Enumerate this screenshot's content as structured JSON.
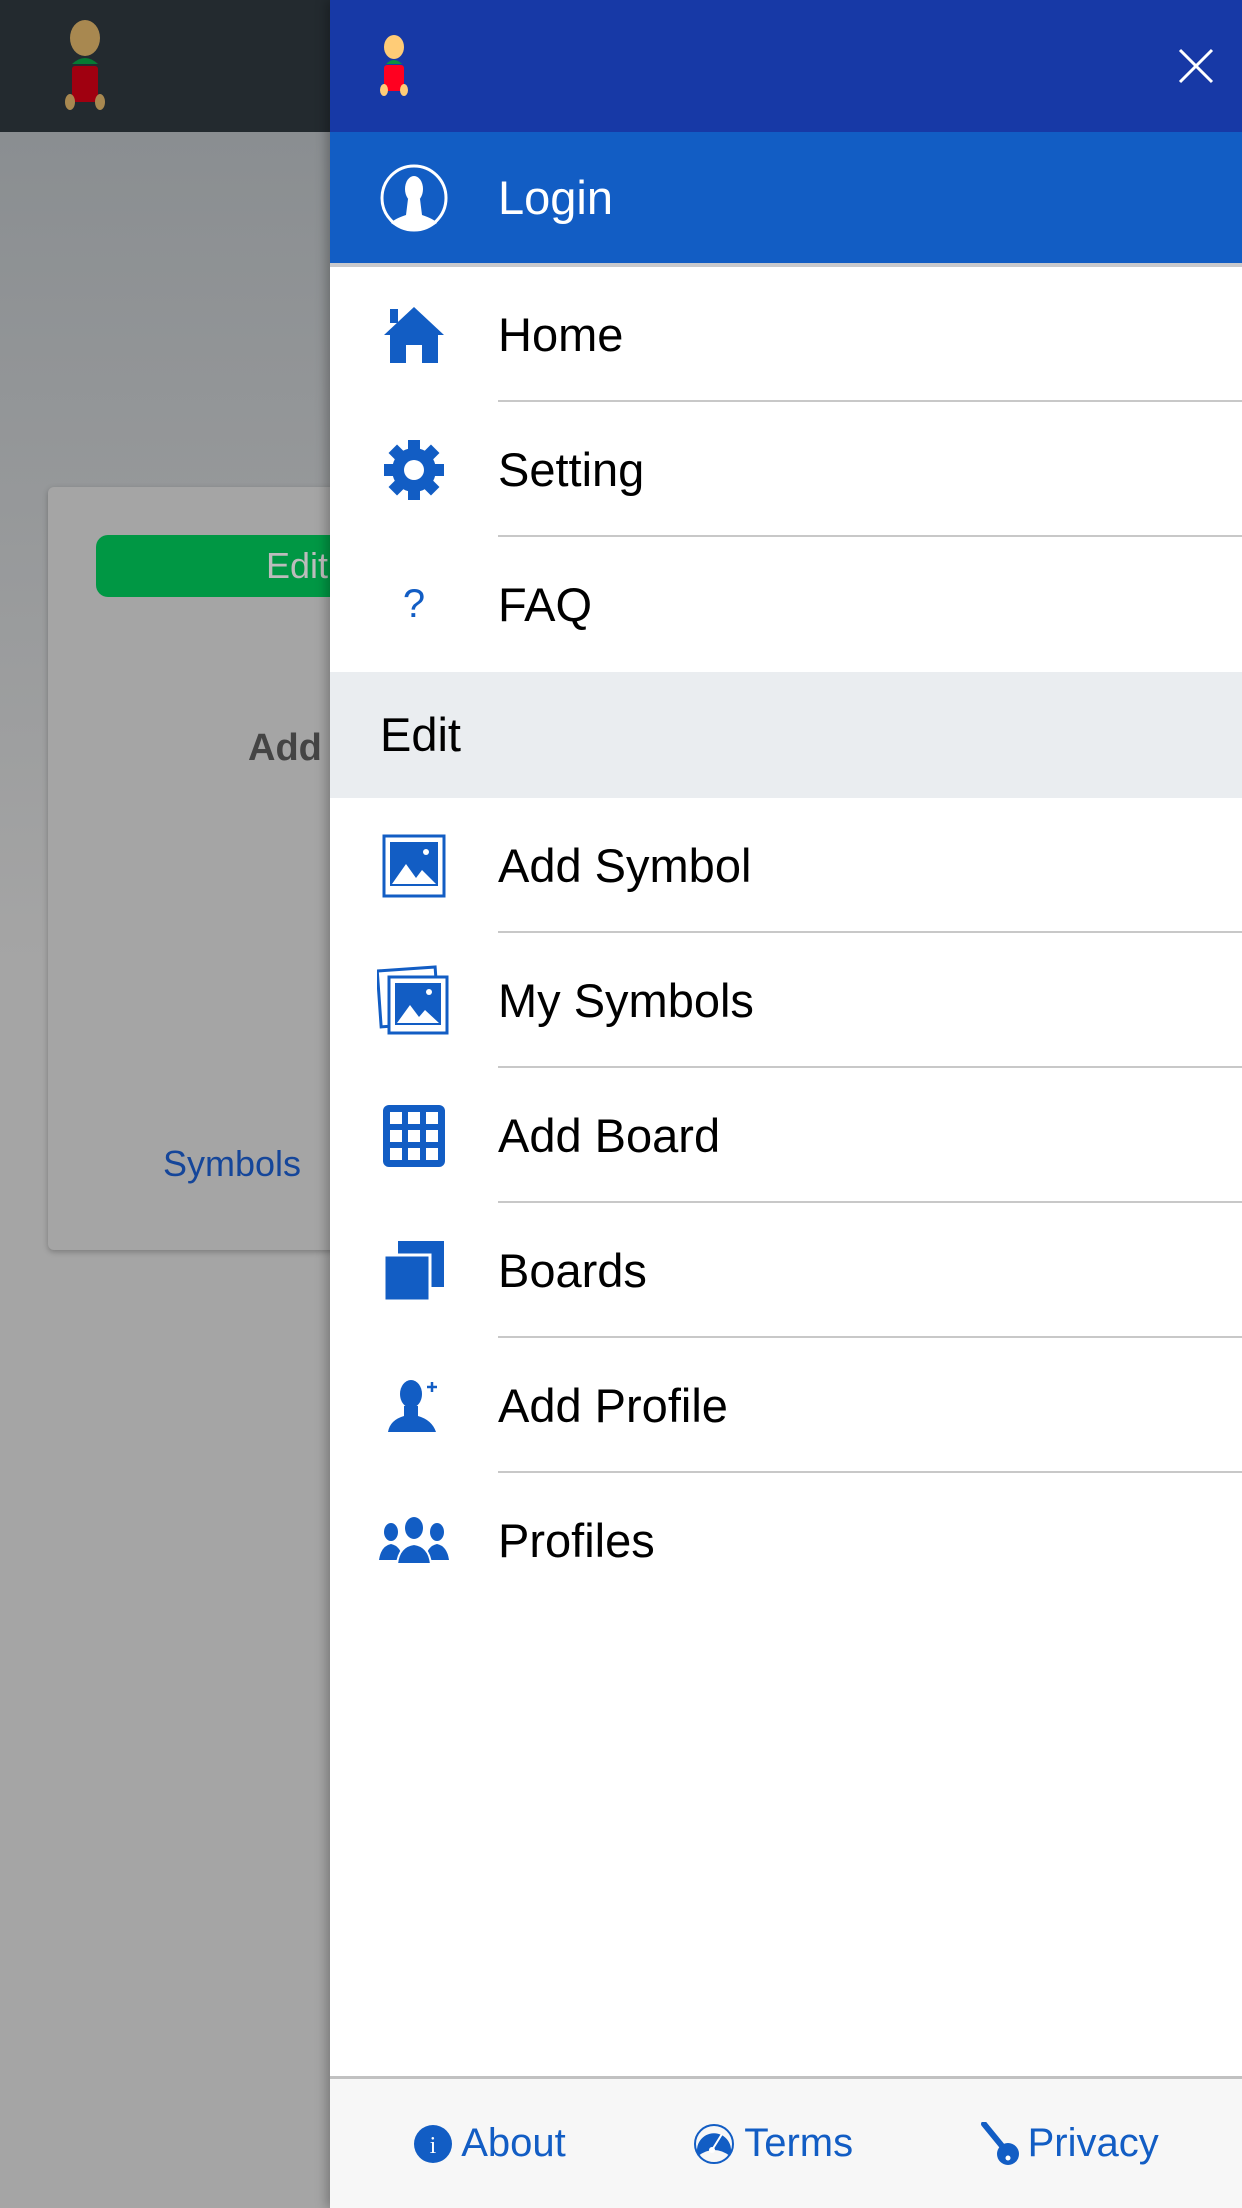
{
  "background": {
    "edit_button": "Edit",
    "add_label": "Add",
    "symbols_link": "Symbols"
  },
  "drawer": {
    "login": "Login",
    "items": [
      {
        "label": "Home",
        "icon": "home-icon"
      },
      {
        "label": "Setting",
        "icon": "gear-icon"
      },
      {
        "label": "FAQ",
        "icon": "question-icon"
      }
    ],
    "section_title": "Edit",
    "edit_items": [
      {
        "label": "Add Symbol",
        "icon": "image-icon"
      },
      {
        "label": "My Symbols",
        "icon": "images-icon"
      },
      {
        "label": "Add Board",
        "icon": "grid-icon"
      },
      {
        "label": "Boards",
        "icon": "stacked-squares-icon"
      },
      {
        "label": "Add Profile",
        "icon": "add-user-icon"
      },
      {
        "label": "Profiles",
        "icon": "users-icon"
      }
    ],
    "footer": {
      "about": "About",
      "terms": "Terms",
      "privacy": "Privacy"
    }
  },
  "colors": {
    "accent": "#125dc4",
    "header": "#1739a6",
    "green": "#009744"
  }
}
